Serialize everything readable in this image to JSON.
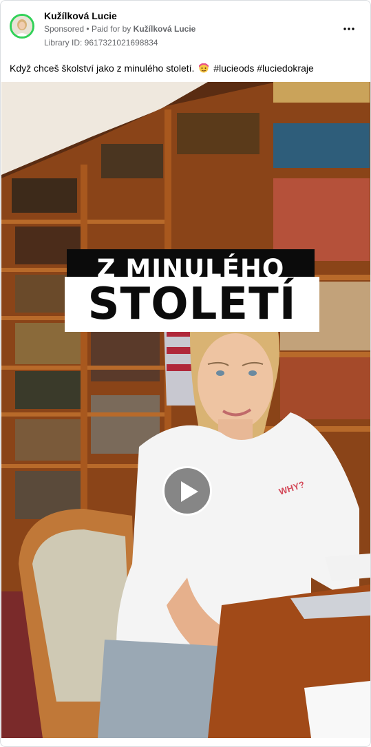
{
  "post": {
    "page_name": "Kužílková Lucie",
    "sponsored": "Sponsored",
    "paid_for_by_prefix": "Paid for by",
    "separator": "•",
    "paid_for_by_name": "Kužílková Lucie",
    "library_id": "Library ID: 9617321021698834",
    "caption_text": "Když chceš školství jako z minulého století.",
    "caption_hashtags": "#lucieods #luciedokraje",
    "avatar_ring_color": "#31d158"
  },
  "video": {
    "overlay_line1": "Z MINULÉHO",
    "overlay_line2": "STOLETÍ",
    "play_icon": "play-icon"
  },
  "icons": {
    "more": "more-options-icon",
    "caption_emoji": "face-emoji-icon"
  }
}
